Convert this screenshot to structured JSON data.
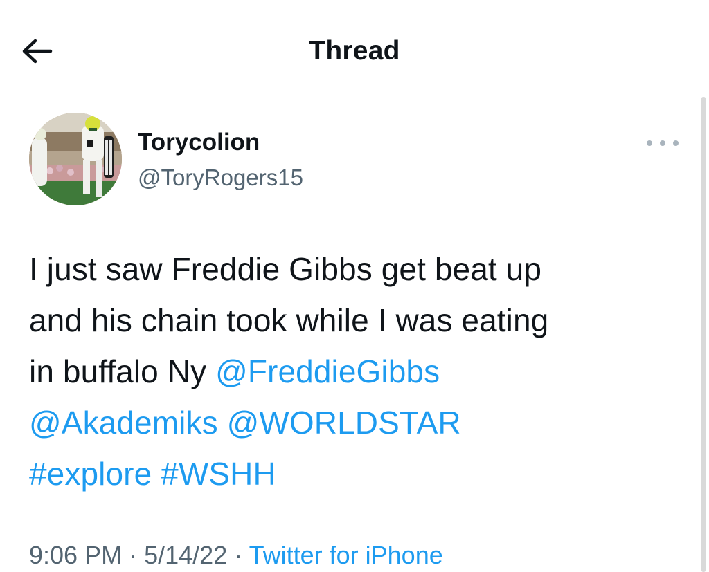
{
  "header": {
    "title": "Thread",
    "back_icon": "arrow-left-icon"
  },
  "tweet": {
    "author": {
      "display_name": "Torycolion",
      "handle": "@ToryRogers15",
      "avatar": "football-player-photo"
    },
    "more_icon": "more-horizontal-icon",
    "text_lines": [
      "I just saw Freddie Gibbs get beat up",
      "and his chain took while I was eating",
      "in buffalo Ny"
    ],
    "mentions": [
      "@FreddieGibbs",
      "@Akademiks",
      "@WORLDSTAR"
    ],
    "hashtags": [
      "#explore",
      "#WSHH"
    ],
    "time": "9:06 PM",
    "date": "5/14/22",
    "separator": "·",
    "source": "Twitter for iPhone"
  },
  "colors": {
    "text": "#0f1419",
    "secondary": "#536471",
    "link": "#1d9bf0",
    "background": "#ffffff"
  }
}
